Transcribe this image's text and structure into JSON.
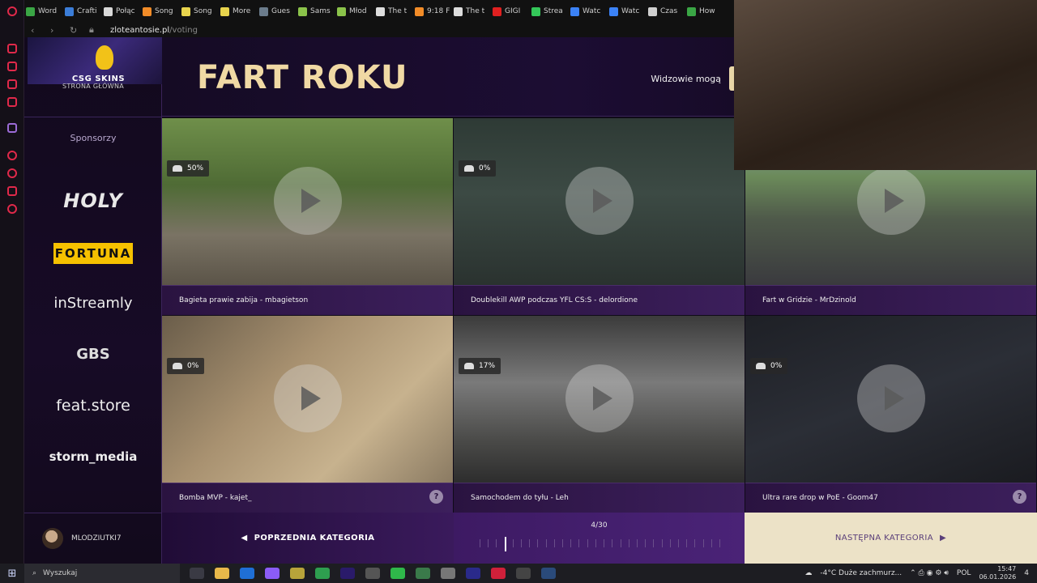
{
  "browser": {
    "bookmarks": [
      {
        "label": "Word",
        "color": "#3aa645"
      },
      {
        "label": "Crafti",
        "color": "#3b7dd8"
      },
      {
        "label": "Połąc",
        "color": "#d9d9d9"
      },
      {
        "label": "Song",
        "color": "#f28c28"
      },
      {
        "label": "Song",
        "color": "#e8d44d"
      },
      {
        "label": "More",
        "color": "#e8d44d"
      },
      {
        "label": "Gues",
        "color": "#6b7c8c"
      },
      {
        "label": "Sams",
        "color": "#8bc34a"
      },
      {
        "label": "Młod",
        "color": "#8bc34a"
      },
      {
        "label": "The t",
        "color": "#dddddd"
      },
      {
        "label": "9:18 F",
        "color": "#f28c28"
      },
      {
        "label": "The t",
        "color": "#dddddd"
      },
      {
        "label": "GIGI",
        "color": "#e02020"
      },
      {
        "label": "Strea",
        "color": "#34c759"
      },
      {
        "label": "Watc",
        "color": "#3b82f6"
      },
      {
        "label": "Watc",
        "color": "#3b82f6"
      },
      {
        "label": "Czas",
        "color": "#cfcfcf"
      },
      {
        "label": "How",
        "color": "#3aa645"
      }
    ],
    "url_domain": "zloteantosie.pl",
    "url_path": "/voting"
  },
  "sidebar": {
    "logo_text": "CSG SKINS",
    "home_label": "STRONA GŁÓWNA",
    "sponsors_title": "Sponsorzy",
    "sponsors": [
      "HOLY",
      "FORTUNA",
      "inStreamly",
      "GBS",
      "feat.store",
      "storm_media"
    ],
    "user_name": "MLODZIUTKI7"
  },
  "header": {
    "title": "FART ROKU",
    "viewers_label": "Widzowie mogą"
  },
  "clips": [
    {
      "title": "Bagieta prawie zabija - mbagietson",
      "percent": "50%",
      "help": false
    },
    {
      "title": "Doublekill AWP podczas YFL CS:S - delordione",
      "percent": "0%",
      "help": false
    },
    {
      "title": "Fart w Gridzie - MrDzinold",
      "percent": "",
      "help": false
    },
    {
      "title": "Bomba MVP - kajet_",
      "percent": "0%",
      "help": true
    },
    {
      "title": "Samochodem do tyłu - Leh",
      "percent": "17%",
      "help": false
    },
    {
      "title": "Ultra rare drop w PoE - Goom47",
      "percent": "0%",
      "help": true
    }
  ],
  "nav": {
    "prev_label": "POPRZEDNIA KATEGORIA",
    "next_label": "NASTĘPNA KATEGORIA",
    "progress_text": "4/30",
    "current": 4,
    "total": 30
  },
  "taskbar": {
    "search_placeholder": "Wyszukaj",
    "weather": "-4°C Duże zachmurz...",
    "lang": "POL",
    "time": "15:47",
    "date": "06.01.2026",
    "notifications": "4"
  },
  "colors": {
    "accent_gold": "#f0d9a4",
    "purple": "#3c1f5c",
    "next_bg": "#ece2c7"
  }
}
